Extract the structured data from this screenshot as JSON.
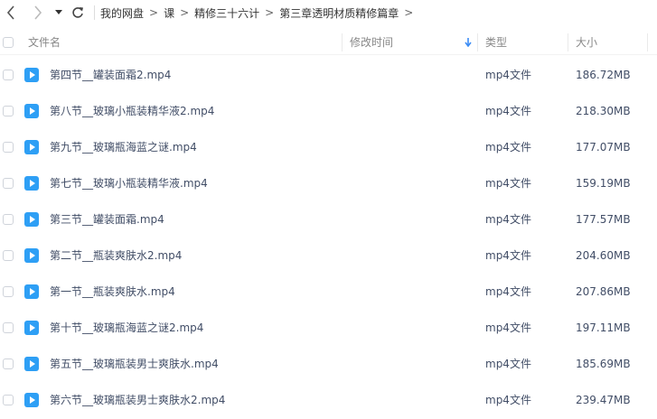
{
  "breadcrumb": [
    "我的网盘",
    "课",
    "精修三十六计",
    "第三章透明材质精修篇章"
  ],
  "header": {
    "name": "文件名",
    "modified": "修改时间",
    "type": "类型",
    "size": "大小",
    "sort_icon": "arrow-down-icon"
  },
  "files": [
    {
      "name": "第四节__罐装面霜2.mp4",
      "type": "mp4文件",
      "size": "186.72MB"
    },
    {
      "name": "第八节__玻璃小瓶装精华液2.mp4",
      "type": "mp4文件",
      "size": "218.30MB"
    },
    {
      "name": "第九节__玻璃瓶海蓝之谜.mp4",
      "type": "mp4文件",
      "size": "177.07MB"
    },
    {
      "name": "第七节__玻璃小瓶装精华液.mp4",
      "type": "mp4文件",
      "size": "159.19MB"
    },
    {
      "name": "第三节__罐装面霜.mp4",
      "type": "mp4文件",
      "size": "177.57MB"
    },
    {
      "name": "第二节__瓶装爽肤水2.mp4",
      "type": "mp4文件",
      "size": "204.60MB"
    },
    {
      "name": "第一节__瓶装爽肤水.mp4",
      "type": "mp4文件",
      "size": "207.86MB"
    },
    {
      "name": "第十节__玻璃瓶海蓝之谜2.mp4",
      "type": "mp4文件",
      "size": "197.11MB"
    },
    {
      "name": "第五节__玻璃瓶装男士爽肤水.mp4",
      "type": "mp4文件",
      "size": "185.69MB"
    },
    {
      "name": "第六节__玻璃瓶装男士爽肤水2.mp4",
      "type": "mp4文件",
      "size": "239.47MB"
    }
  ],
  "colors": {
    "accent": "#3b8cf5",
    "icon_blue": "#2e9ff5",
    "text": "#424e67"
  },
  "icons": {
    "back": "chevron-left-icon",
    "forward": "chevron-right-icon",
    "dropdown": "triangle-down-icon",
    "refresh": "refresh-icon",
    "file": "video-file-icon"
  }
}
